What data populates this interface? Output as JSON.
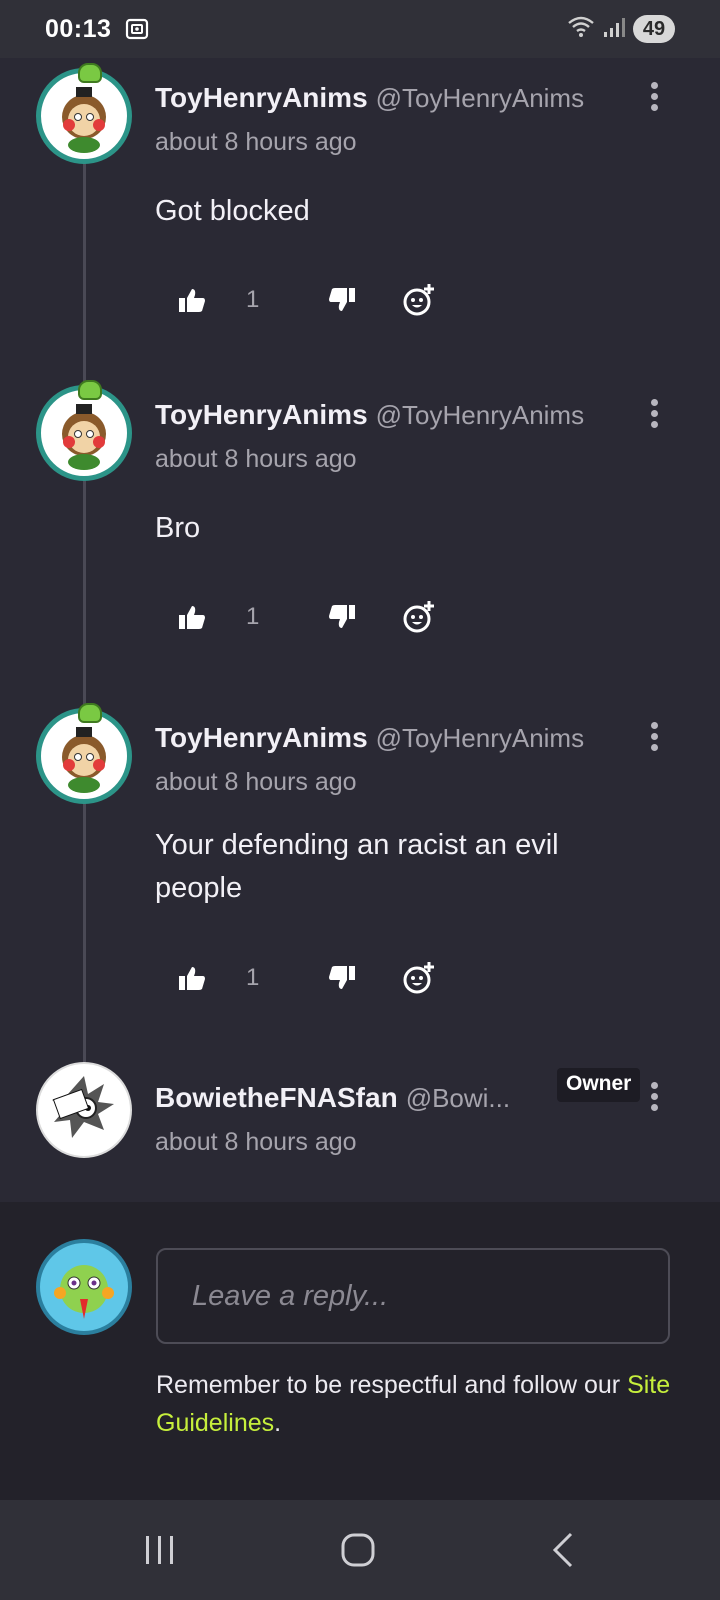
{
  "status_bar": {
    "time": "00:13",
    "battery": "49",
    "icons": [
      "screen-record-icon",
      "wifi-icon",
      "signal-icon",
      "battery-icon"
    ]
  },
  "comments": [
    {
      "username": "ToyHenryAnims",
      "handle": "@ToyHenryAnims",
      "timestamp": "about 8 hours ago",
      "text": "Got blocked",
      "likes": "1"
    },
    {
      "username": "ToyHenryAnims",
      "handle": "@ToyHenryAnims",
      "timestamp": "about 8 hours ago",
      "text": "Bro",
      "likes": "1"
    },
    {
      "username": "ToyHenryAnims",
      "handle": "@ToyHenryAnims",
      "timestamp": "about 8 hours ago",
      "text": "Your defending an racist an evil people",
      "likes": "1"
    },
    {
      "username": "BowietheFNASfan",
      "handle": "@Bowi...",
      "badge": "Owner",
      "timestamp": "about 8 hours ago"
    }
  ],
  "reply": {
    "placeholder": "Leave a reply...",
    "notice": "Remember to be respectful and follow our",
    "link": "Site Guidelines",
    "after_link": "."
  },
  "colors": {
    "background": "#2a2934",
    "reply_background": "#23222a",
    "link": "#c6ef3c",
    "avatar_ring": "#2c9488"
  }
}
